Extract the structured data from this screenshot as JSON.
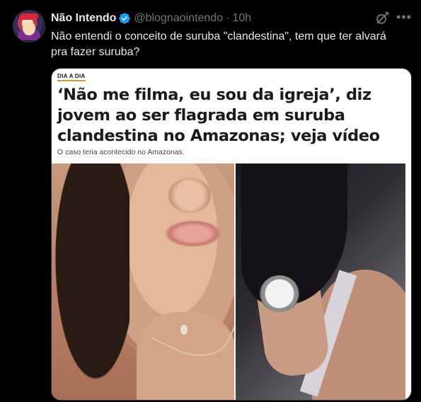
{
  "tweet": {
    "author_name": "Não Intendo",
    "handle": "@blognaointendo",
    "separator": "·",
    "time": "10h",
    "text": "Não entendi o conceito de suruba \"clandestina\", tem que ter alvará pra fazer suruba?",
    "more_label": "•••"
  },
  "article": {
    "tag": "DIA A DIA",
    "headline": "‘Não me filma, eu sou da igreja’, diz jovem ao ser flagrada em suruba clandestina no Amazonas; veja vídeo",
    "subtitle": "O caso teria acontecido no Amazonas."
  },
  "icons": {
    "verified": "verified-badge-icon",
    "grok": "grok-icon",
    "more": "more-icon"
  },
  "colors": {
    "background": "#000000",
    "text_primary": "#e7e9ea",
    "text_secondary": "#71767b",
    "verified_blue": "#1d9bf0"
  }
}
